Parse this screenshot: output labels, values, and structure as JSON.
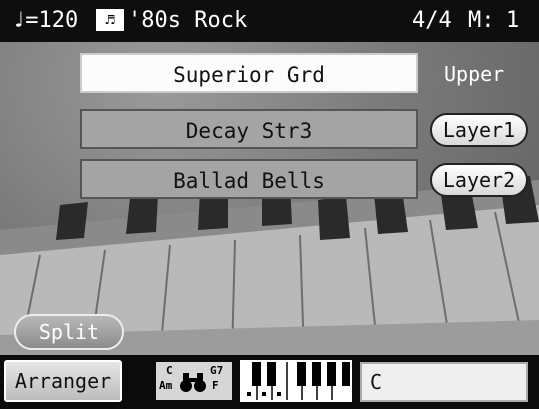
{
  "status_bar": {
    "tempo": "♩=120",
    "style_icon": "♬",
    "style_name": "'80s Rock",
    "beat": "4/4",
    "measure_label": "M:",
    "measure": "1"
  },
  "tones": {
    "upper": "Superior Grd",
    "layer1": "Decay Str3",
    "layer2": "Ballad Bells"
  },
  "labels": {
    "upper": "Upper",
    "layer1_button": "Layer1",
    "layer2_button": "Layer2",
    "split_button": "Split",
    "arranger_button": "Arranger"
  },
  "chord_icon": {
    "top_left": "C",
    "bottom_left": "Am",
    "top_right": "G7",
    "bottom_right": "F"
  },
  "chord_display": "C",
  "colors": {
    "bar_bg": "#0e0e0e",
    "active_tone_bg": "#fcfcfc",
    "layer_tone_bg": "#a4a4a4"
  }
}
